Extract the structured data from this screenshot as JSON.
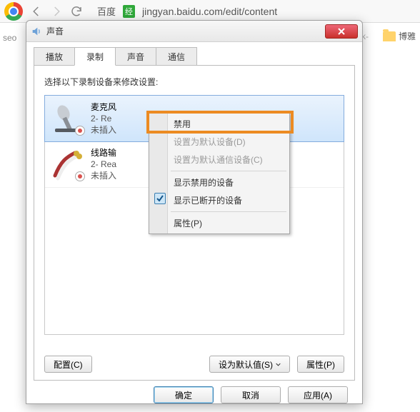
{
  "browser": {
    "url_prefix": "百度",
    "url_badge": "经",
    "url": "jingyan.baidu.com/edit/content"
  },
  "bg": {
    "left_text": "seo",
    "folder_label": "博雅",
    "right_frag": "ak-"
  },
  "dialog": {
    "title": "声音",
    "tabs": [
      "播放",
      "录制",
      "声音",
      "通信"
    ],
    "active_tab_index": 1,
    "prompt": "选择以下录制设备来修改设置:",
    "devices": [
      {
        "name": "麦克风",
        "line2": "2- Re",
        "line3": "未插入"
      },
      {
        "name": "线路输",
        "line2": "2- Rea",
        "line3": "未插入"
      }
    ],
    "buttons": {
      "configure": "配置(C)",
      "set_default": "设为默认值(S)",
      "properties": "属性(P)",
      "ok": "确定",
      "cancel": "取消",
      "apply": "应用(A)"
    }
  },
  "context_menu": {
    "items": [
      {
        "label": "禁用",
        "disabled": false
      },
      {
        "label": "设置为默认设备(D)",
        "disabled": true
      },
      {
        "label": "设置为默认通信设备(C)",
        "disabled": true
      }
    ],
    "items2": [
      {
        "label": "显示禁用的设备",
        "checked": false
      },
      {
        "label": "显示已断开的设备",
        "checked": true
      }
    ],
    "items3": [
      {
        "label": "属性(P)"
      }
    ]
  }
}
